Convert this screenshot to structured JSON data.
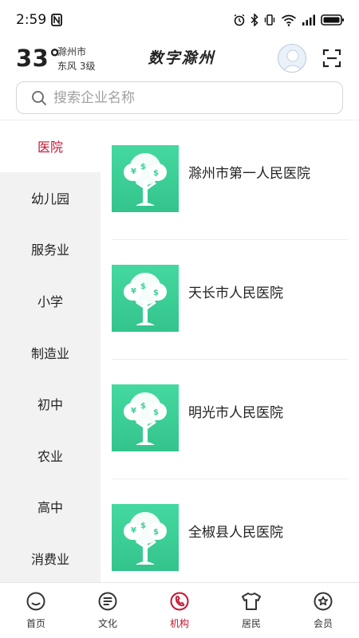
{
  "status_bar": {
    "time": "2:59",
    "icons": [
      "nfc-icon",
      "alarm-icon",
      "bluetooth-icon",
      "vibrate-icon",
      "wifi-icon",
      "signal-icon",
      "battery-icon"
    ]
  },
  "header": {
    "temperature": "33°",
    "city": "滁州市",
    "wind": "东风  3级",
    "title": "数字滁州",
    "avatar_icon": "user-avatar-icon",
    "scan_icon": "scan-icon"
  },
  "search": {
    "placeholder": "搜索企业名称",
    "icon": "search-icon"
  },
  "categories": [
    {
      "label": "医院",
      "active": true
    },
    {
      "label": "幼儿园",
      "active": false
    },
    {
      "label": "服务业",
      "active": false
    },
    {
      "label": "小学",
      "active": false
    },
    {
      "label": "制造业",
      "active": false
    },
    {
      "label": "初中",
      "active": false
    },
    {
      "label": "农业",
      "active": false
    },
    {
      "label": "高中",
      "active": false
    },
    {
      "label": "消费业",
      "active": false
    }
  ],
  "institutions": [
    {
      "name": "滁州市第一人民医院",
      "icon": "money-tree-icon"
    },
    {
      "name": "天长市人民医院",
      "icon": "money-tree-icon"
    },
    {
      "name": "明光市人民医院",
      "icon": "money-tree-icon"
    },
    {
      "name": "全椒县人民医院",
      "icon": "money-tree-icon"
    }
  ],
  "bottom_nav": [
    {
      "label": "首页",
      "icon": "home-icon",
      "active": false
    },
    {
      "label": "文化",
      "icon": "culture-icon",
      "active": false
    },
    {
      "label": "机构",
      "icon": "institution-icon",
      "active": true
    },
    {
      "label": "居民",
      "icon": "resident-icon",
      "active": false
    },
    {
      "label": "会员",
      "icon": "member-icon",
      "active": false
    }
  ],
  "colors": {
    "accent": "#c8102e",
    "sidebar_bg": "#f2f2f2",
    "thumb_gradient_top": "#3fd59a",
    "thumb_gradient_bottom": "#36c690"
  }
}
